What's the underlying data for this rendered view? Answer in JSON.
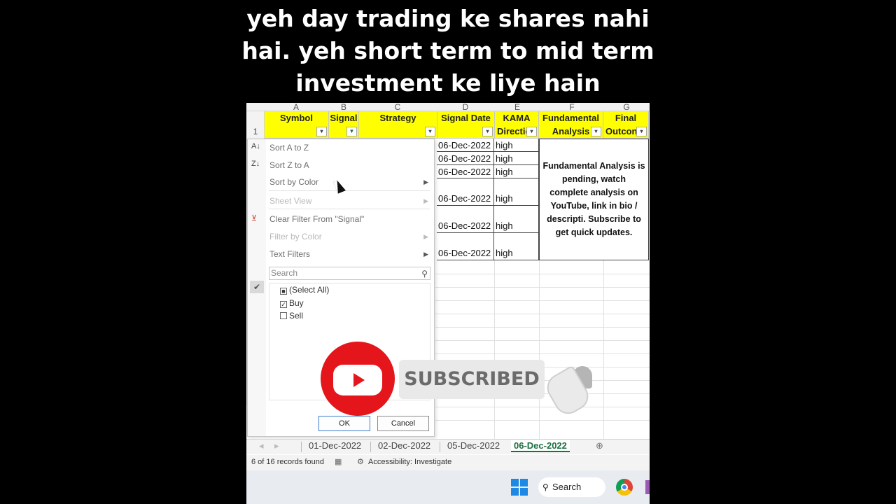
{
  "caption": {
    "line1": "yeh day trading ke shares nahi",
    "line2": "hai. yeh short term to mid term",
    "line3": "investment ke liye hain"
  },
  "sheet": {
    "columns": [
      "A",
      "B",
      "C",
      "D",
      "E",
      "F",
      "G"
    ],
    "row_number": "1",
    "headers": {
      "symbol": "Symbol",
      "signal": "Signal",
      "strategy": "Strategy",
      "signal_date": "Signal Date",
      "kama_1": "KAMA",
      "kama_2": "Directio",
      "fund_1": "Fundamental",
      "fund_2": "Analysis",
      "final_1": "Final",
      "final_2": "Outcon"
    },
    "rows": [
      {
        "date": "06-Dec-2022",
        "kama": "high"
      },
      {
        "date": "06-Dec-2022",
        "kama": "high"
      },
      {
        "date": "06-Dec-2022",
        "kama": "high"
      },
      {
        "date": "06-Dec-2022",
        "kama": "high"
      },
      {
        "date": "06-Dec-2022",
        "kama": "high"
      },
      {
        "date": "06-Dec-2022",
        "kama": "high"
      }
    ],
    "merged_note": "Fundamental Analysis is pending, watch complete analysis on YouTube, link in bio / descripti. Subscribe to get quick updates."
  },
  "filter_menu": {
    "sort_az": "Sort A to Z",
    "sort_za": "Sort Z to A",
    "sort_color": "Sort by Color",
    "sheet_view": "Sheet View",
    "clear_filter": "Clear Filter From \"Signal\"",
    "filter_color": "Filter by Color",
    "text_filters": "Text Filters",
    "search_placeholder": "Search",
    "items": [
      {
        "label": "(Select All)",
        "state": "partial"
      },
      {
        "label": "Buy",
        "state": "checked"
      },
      {
        "label": "Sell",
        "state": "unchecked"
      }
    ],
    "ok": "OK",
    "cancel": "Cancel"
  },
  "tabs": [
    {
      "label": "01-Dec-2022",
      "active": false
    },
    {
      "label": "02-Dec-2022",
      "active": false
    },
    {
      "label": "05-Dec-2022",
      "active": false
    },
    {
      "label": "06-Dec-2022",
      "active": true
    }
  ],
  "status": {
    "records": "6 of 16 records found",
    "accessibility": "Accessibility: Investigate"
  },
  "taskbar": {
    "search": "Search"
  },
  "overlay": {
    "subscribed": "SUBSCRIBED"
  },
  "colors": {
    "header_fill": "#ffff00",
    "excel_green": "#1d6f42",
    "youtube_red": "#e4161b"
  }
}
